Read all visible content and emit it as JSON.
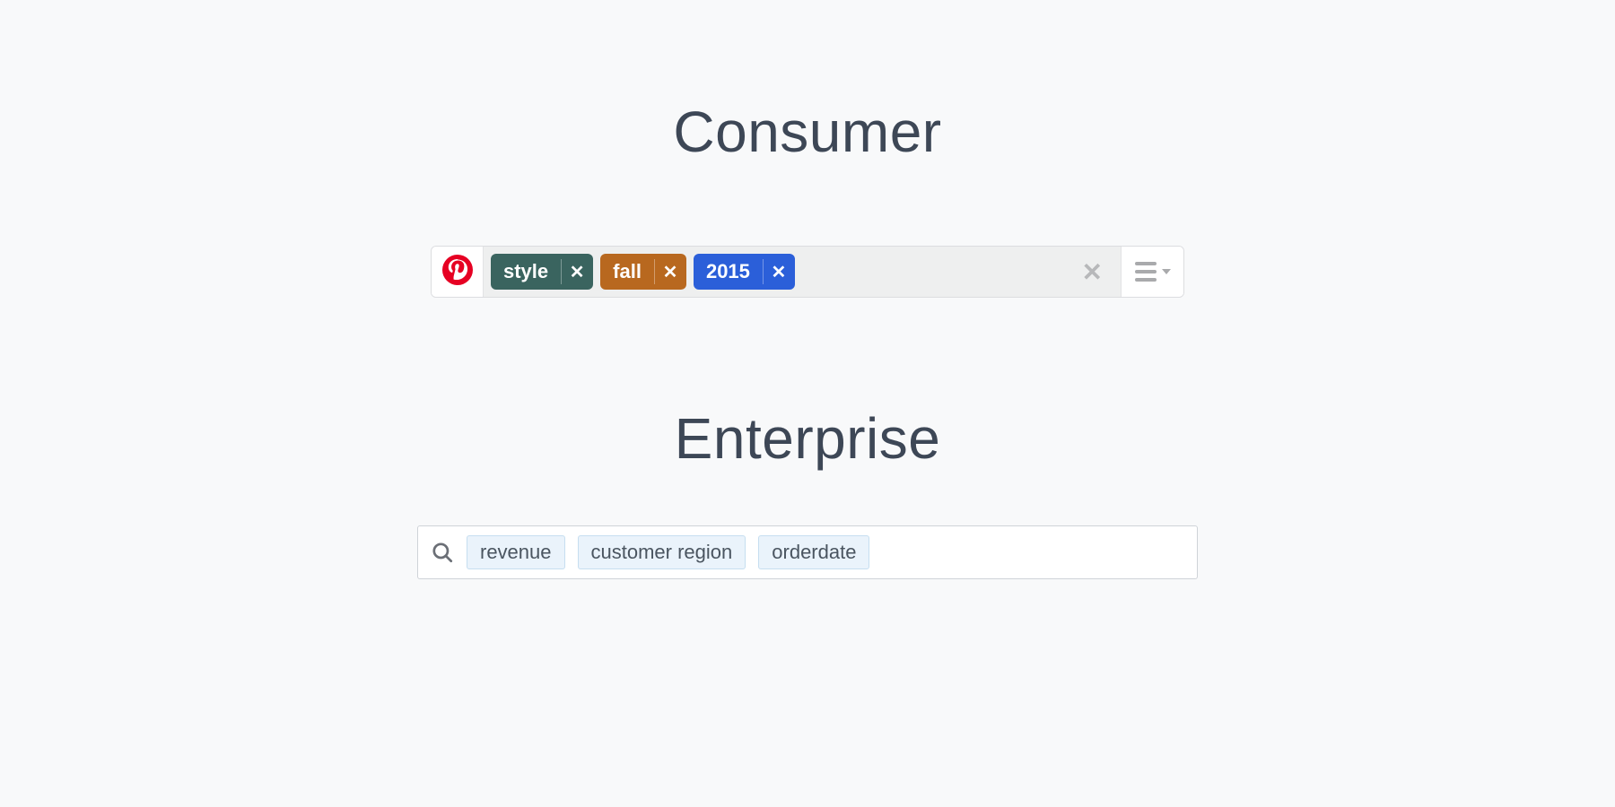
{
  "consumer": {
    "heading": "Consumer",
    "brand_icon": "pinterest-icon",
    "brand_color": "#e60023",
    "tags": [
      {
        "label": "style",
        "bg": "#3a645f"
      },
      {
        "label": "fall",
        "bg": "#b8681f"
      },
      {
        "label": "2015",
        "bg": "#2b5fd9"
      }
    ],
    "tag_remove_glyph": "✕",
    "clear_glyph": "✕",
    "menu_icon": "hamburger-icon"
  },
  "enterprise": {
    "heading": "Enterprise",
    "search_icon": "search-icon",
    "tags": [
      {
        "label": "revenue"
      },
      {
        "label": "customer region"
      },
      {
        "label": "orderdate"
      }
    ],
    "tag_bg": "#eaf3fb",
    "tag_border": "#c6def0"
  }
}
